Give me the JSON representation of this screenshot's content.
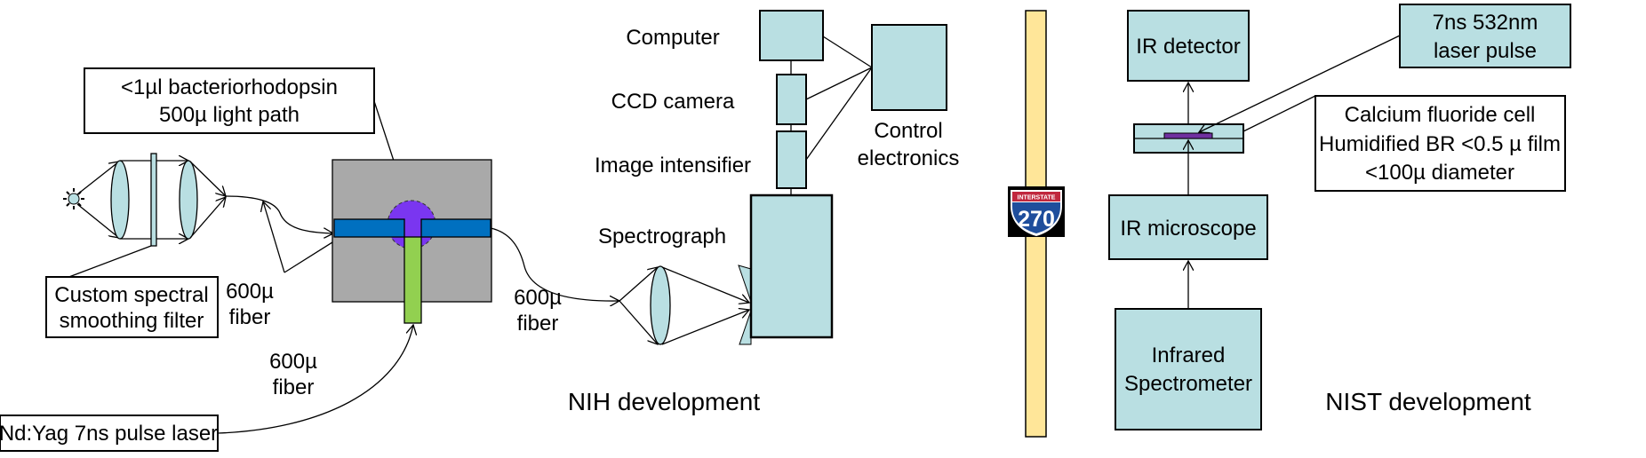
{
  "colors": {
    "component_fill": "#b9dfe2",
    "cell_gray": "#a9a9a9",
    "fiber_blue": "#0070c0",
    "sample_purple": "#7a36f0",
    "laser_fiber_green": "#92d050",
    "divider_yellow": "#ffe699",
    "film_purple": "#7030a0",
    "shield_blue": "#1f4e9c",
    "shield_red": "#c0273d"
  },
  "nih": {
    "title": "NIH development",
    "sample_label": {
      "line1": "<1µl  bacteriorhodopsin",
      "line2": "500µ light path"
    },
    "filter_label": {
      "line1": "Custom spectral",
      "line2": "smoothing filter"
    },
    "laser_label": "Nd:Yag 7ns pulse laser",
    "fiber_labels": [
      {
        "line1": "600µ",
        "line2": "fiber"
      },
      {
        "line1": "600µ",
        "line2": "fiber"
      },
      {
        "line1": "600µ",
        "line2": "fiber"
      }
    ],
    "components": {
      "computer": "Computer",
      "ccd_camera": "CCD camera",
      "image_intensifier": "Image intensifier",
      "spectrograph": "Spectrograph",
      "control_electronics": {
        "line1": "Control",
        "line2": "electronics"
      }
    },
    "light_source_icon": "sun-icon"
  },
  "divider": {
    "sign_top": "INTERSTATE",
    "sign_number": "270",
    "icon": "interstate-shield-icon"
  },
  "nist": {
    "title": "NIST development",
    "ir_detector": "IR detector",
    "laser_pulse": {
      "line1": "7ns 532nm",
      "line2": "laser pulse"
    },
    "cell_label": {
      "line1": "Calcium fluoride cell",
      "line2": "Humidified BR <0.5 µ film",
      "line3": "<100µ diameter"
    },
    "ir_microscope": "IR microscope",
    "spectrometer": {
      "line1": "Infrared",
      "line2": "Spectrometer"
    }
  }
}
